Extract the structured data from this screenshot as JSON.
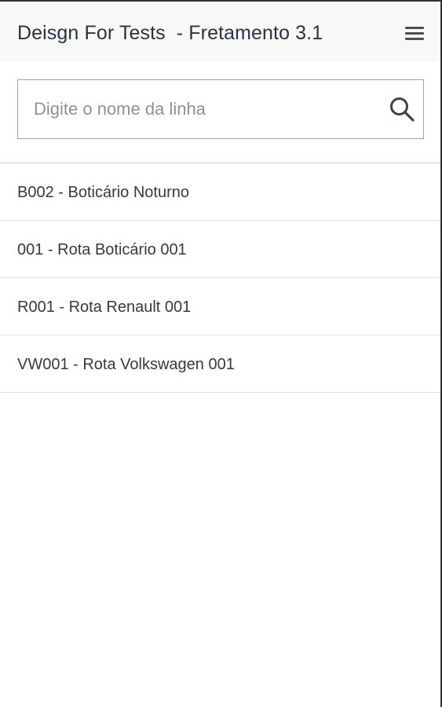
{
  "header": {
    "title": "Deisgn For Tests  - Fretamento 3.1",
    "menu_icon": "hamburger-menu-icon"
  },
  "search": {
    "placeholder": "Digite o nome da linha",
    "value": "",
    "icon": "search-icon"
  },
  "routes": [
    {
      "label": "B002 - Boticário Noturno"
    },
    {
      "label": "001 - Rota Boticário 001"
    },
    {
      "label": "R001 - Rota Renault 001"
    },
    {
      "label": "VW001 - Rota Volkswagen 001"
    }
  ],
  "colors": {
    "text": "#343a42",
    "header_background": "#f8f8f8",
    "border": "#9ea3a9"
  }
}
